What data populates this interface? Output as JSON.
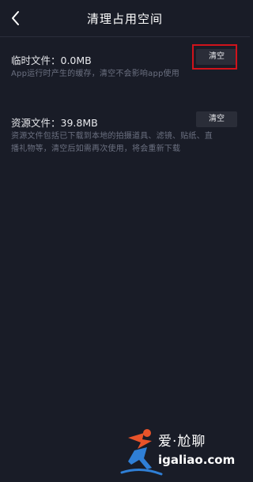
{
  "header": {
    "title": "清理占用空间",
    "back_icon": "chevron-left-icon"
  },
  "temp_files": {
    "title": "临时文件：0.0MB",
    "description": "App运行时产生的缓存，清空不会影响app使用",
    "button_label": "清空"
  },
  "resource_files": {
    "title": "资源文件：39.8MB",
    "description_line1": "资源文件包括已下载到本地的拍摄道具、滤镜、贴纸、直",
    "description_line2": "播礼物等，清空后如需再次使用，将会重新下载",
    "button_label": "清空"
  },
  "highlight": {
    "color": "#d0131b"
  },
  "watermark": {
    "text_cn": "爱·尬聊",
    "text_en": "igaliao.com",
    "icon": "runner-logo-icon",
    "colors": [
      "#e8532a",
      "#2f7fd6"
    ]
  },
  "theme": {
    "background": "#191c27",
    "button_bg": "#2a2d38",
    "secondary_text": "#6b7080"
  }
}
